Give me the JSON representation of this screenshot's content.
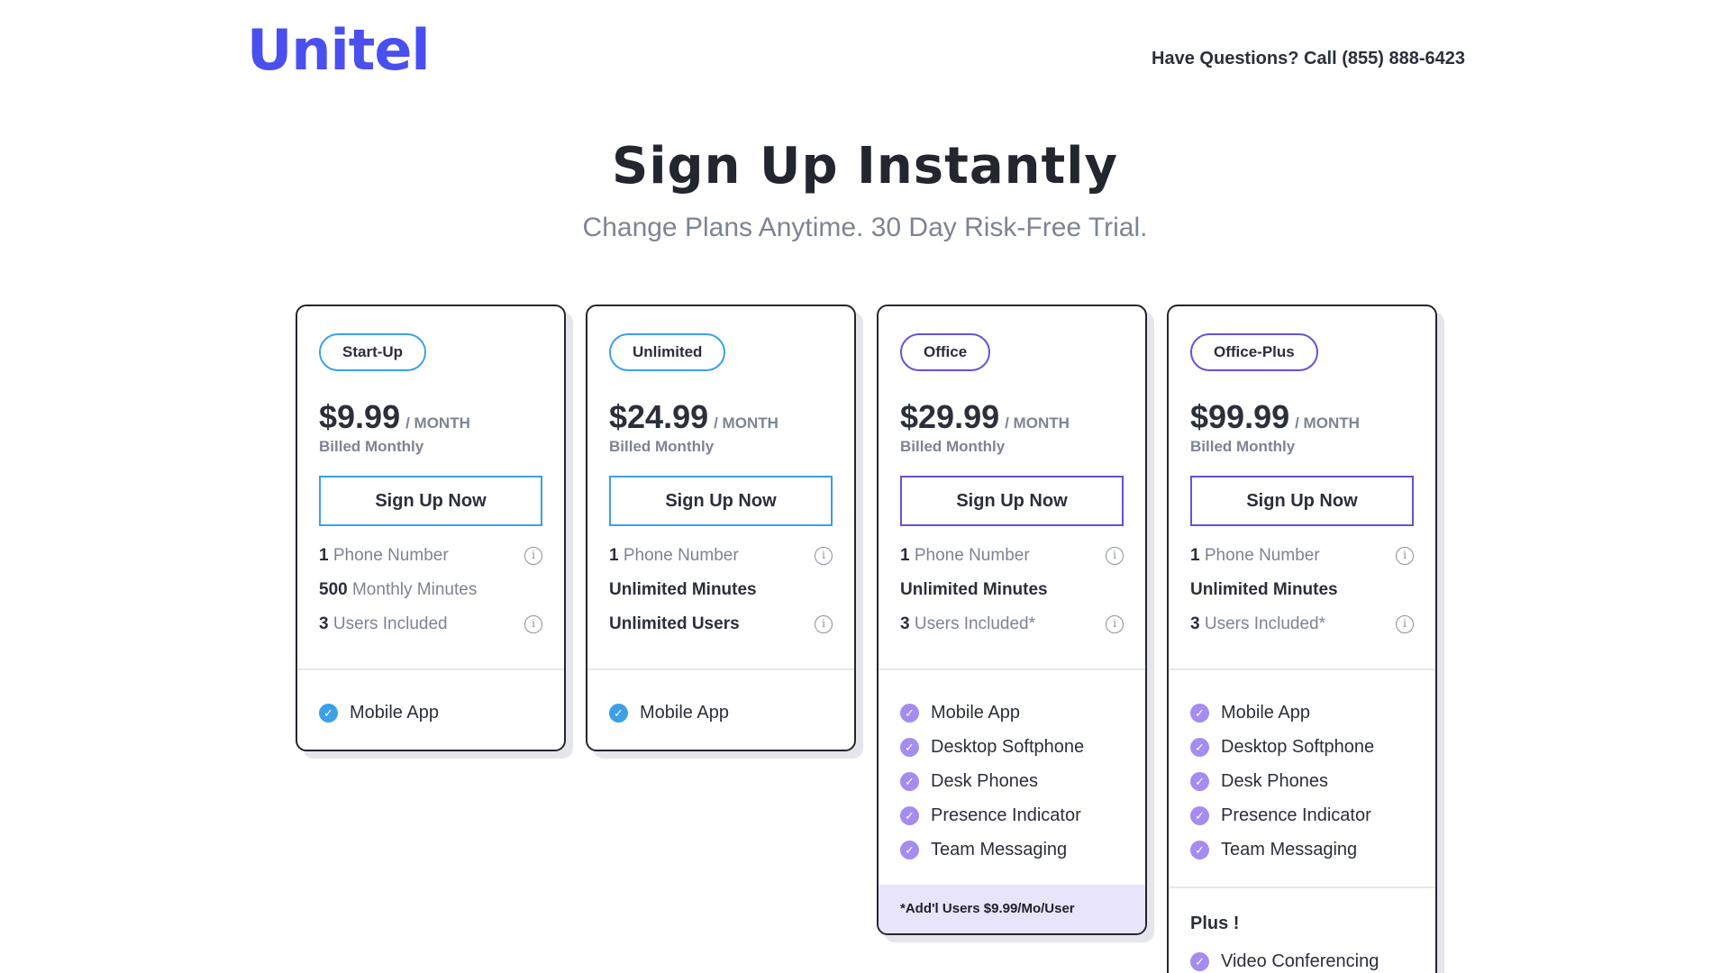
{
  "header": {
    "logo": "Unitel",
    "contact": "Have Questions? Call (855) 888-6423"
  },
  "hero": {
    "title": "Sign Up Instantly",
    "subtitle": "Change Plans Anytime. 30 Day Risk-Free Trial."
  },
  "colors": {
    "brand": "#4a4ff0",
    "blue_accent": "#3ca0e8",
    "purple_accent": "#6b4fd8",
    "purple_check": "#a48cf0",
    "note_bg": "#e8e4fb"
  },
  "plans": [
    {
      "name": "Start-Up",
      "price": "$9.99",
      "per": "/ MONTH",
      "billed": "Billed Monthly",
      "cta": "Sign Up Now",
      "specs": [
        {
          "num": "1",
          "text": "Phone Number",
          "info": true
        },
        {
          "num": "500",
          "text": "Monthly Minutes",
          "info": false
        },
        {
          "num": "3",
          "text": "Users Included",
          "info": true
        }
      ],
      "features": [
        "Mobile App"
      ]
    },
    {
      "name": "Unlimited",
      "price": "$24.99",
      "per": "/ MONTH",
      "billed": "Billed Monthly",
      "cta": "Sign Up Now",
      "specs": [
        {
          "num": "1",
          "text": "Phone Number",
          "info": true
        },
        {
          "bold": "Unlimited Minutes",
          "info": false
        },
        {
          "bold": "Unlimited Users",
          "info": true
        }
      ],
      "features": [
        "Mobile App"
      ]
    },
    {
      "name": "Office",
      "price": "$29.99",
      "per": "/ MONTH",
      "billed": "Billed Monthly",
      "cta": "Sign Up Now",
      "specs": [
        {
          "num": "1",
          "text": "Phone Number",
          "info": true
        },
        {
          "bold": "Unlimited Minutes",
          "info": false
        },
        {
          "num": "3",
          "text": "Users Included*",
          "info": true
        }
      ],
      "features": [
        "Mobile App",
        "Desktop Softphone",
        "Desk Phones",
        "Presence Indicator",
        "Team Messaging"
      ],
      "note": "*Add'l Users $9.99/Mo/User"
    },
    {
      "name": "Office-Plus",
      "price": "$99.99",
      "per": "/ MONTH",
      "billed": "Billed Monthly",
      "cta": "Sign Up Now",
      "specs": [
        {
          "num": "1",
          "text": "Phone Number",
          "info": true
        },
        {
          "bold": "Unlimited Minutes",
          "info": false
        },
        {
          "num": "3",
          "text": "Users Included*",
          "info": true
        }
      ],
      "features": [
        "Mobile App",
        "Desktop Softphone",
        "Desk Phones",
        "Presence Indicator",
        "Team Messaging"
      ],
      "plus_title": "Plus !",
      "plus_features": [
        "Video Conferencing"
      ]
    }
  ],
  "icons": {
    "check": "check-circle-icon",
    "info": "info-icon"
  }
}
